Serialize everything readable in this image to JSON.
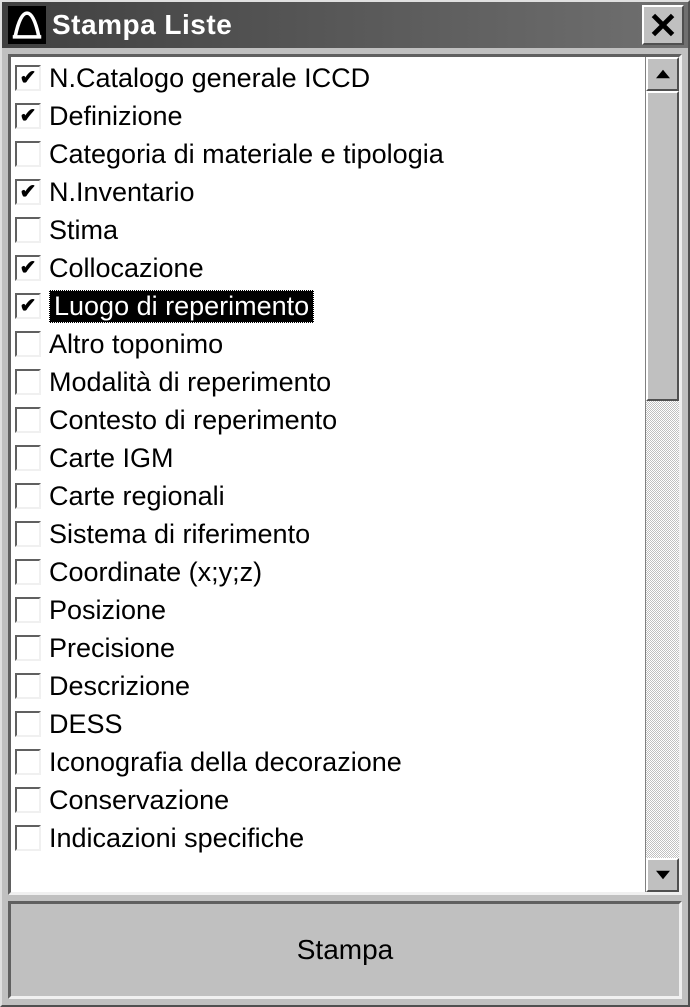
{
  "window": {
    "title": "Stampa Liste"
  },
  "list": {
    "items": [
      {
        "label": "N.Catalogo generale ICCD",
        "checked": true,
        "selected": false
      },
      {
        "label": "Definizione",
        "checked": true,
        "selected": false
      },
      {
        "label": "Categoria di materiale e tipologia",
        "checked": false,
        "selected": false
      },
      {
        "label": "N.Inventario",
        "checked": true,
        "selected": false
      },
      {
        "label": "Stima",
        "checked": false,
        "selected": false
      },
      {
        "label": "Collocazione",
        "checked": true,
        "selected": false
      },
      {
        "label": "Luogo di reperimento",
        "checked": true,
        "selected": true
      },
      {
        "label": "Altro toponimo",
        "checked": false,
        "selected": false
      },
      {
        "label": "Modalità di reperimento",
        "checked": false,
        "selected": false
      },
      {
        "label": "Contesto di reperimento",
        "checked": false,
        "selected": false
      },
      {
        "label": "Carte IGM",
        "checked": false,
        "selected": false
      },
      {
        "label": "Carte regionali",
        "checked": false,
        "selected": false
      },
      {
        "label": "Sistema di riferimento",
        "checked": false,
        "selected": false
      },
      {
        "label": "Coordinate (x;y;z)",
        "checked": false,
        "selected": false
      },
      {
        "label": "Posizione",
        "checked": false,
        "selected": false
      },
      {
        "label": "Precisione",
        "checked": false,
        "selected": false
      },
      {
        "label": "Descrizione",
        "checked": false,
        "selected": false
      },
      {
        "label": "DESS",
        "checked": false,
        "selected": false
      },
      {
        "label": "Iconografia della decorazione",
        "checked": false,
        "selected": false
      },
      {
        "label": "Conservazione",
        "checked": false,
        "selected": false
      },
      {
        "label": "Indicazioni specifiche",
        "checked": false,
        "selected": false
      }
    ]
  },
  "buttons": {
    "print": "Stampa"
  }
}
